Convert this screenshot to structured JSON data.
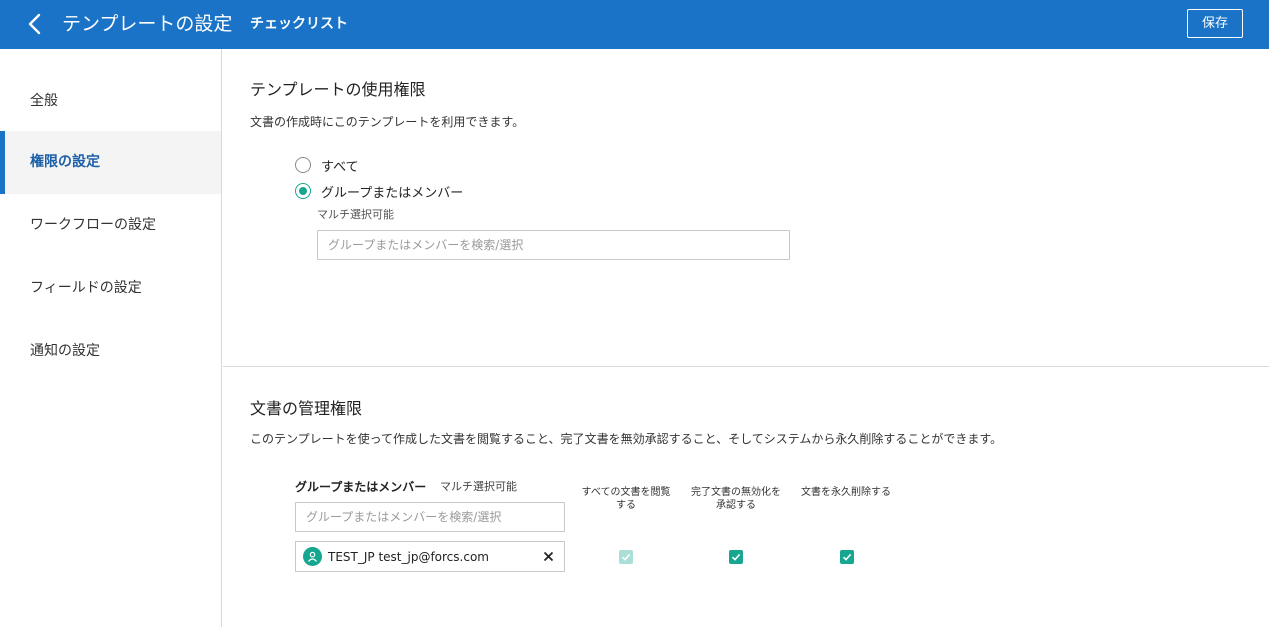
{
  "header": {
    "title": "テンプレートの設定",
    "subtitle": "チェックリスト",
    "save_label": "保存",
    "back_icon": "chevron-left-icon",
    "background_color": "#1a73c6"
  },
  "sidebar": {
    "items": [
      {
        "label": "全般",
        "active": false
      },
      {
        "label": "権限の設定",
        "active": true
      },
      {
        "label": "ワークフローの設定",
        "active": false
      },
      {
        "label": "フィールドの設定",
        "active": false
      },
      {
        "label": "通知の設定",
        "active": false
      }
    ]
  },
  "usage_section": {
    "title": "テンプレートの使用権限",
    "description": "文書の作成時にこのテンプレートを利用できます。",
    "options": [
      {
        "label": "すべて",
        "checked": false
      },
      {
        "label": "グループまたはメンバー",
        "checked": true
      }
    ],
    "multi_hint": "マルチ選択可能",
    "search_placeholder": "グループまたはメンバーを検索/選択"
  },
  "admin_section": {
    "title": "文書の管理権限",
    "description": "このテンプレートを使って作成した文書を閲覧すること、完了文書を無効承認すること、そしてシステムから永久削除することができます。",
    "member_column_label": "グループまたはメンバー",
    "multi_hint": "マルチ選択可能",
    "search_placeholder": "グループまたはメンバーを検索/選択",
    "permission_columns": [
      {
        "line1": "すべての文書を閲覧",
        "line2": "する"
      },
      {
        "line1": "完了文書の無効化を",
        "line2": "承認する"
      },
      {
        "line1": "文書を永久削除する",
        "line2": ""
      }
    ],
    "members": [
      {
        "name": "TEST_JP test_jp@forcs.com",
        "avatar_icon": "user-avatar-icon",
        "view_all": {
          "checked": true,
          "disabled": true
        },
        "approve_invalidation": {
          "checked": true,
          "disabled": false
        },
        "permanent_delete": {
          "checked": true,
          "disabled": false
        }
      }
    ]
  },
  "colors": {
    "accent": "#17a68f",
    "accent_disabled": "#a9dfd6",
    "active_nav_text": "#1a5fa8"
  }
}
